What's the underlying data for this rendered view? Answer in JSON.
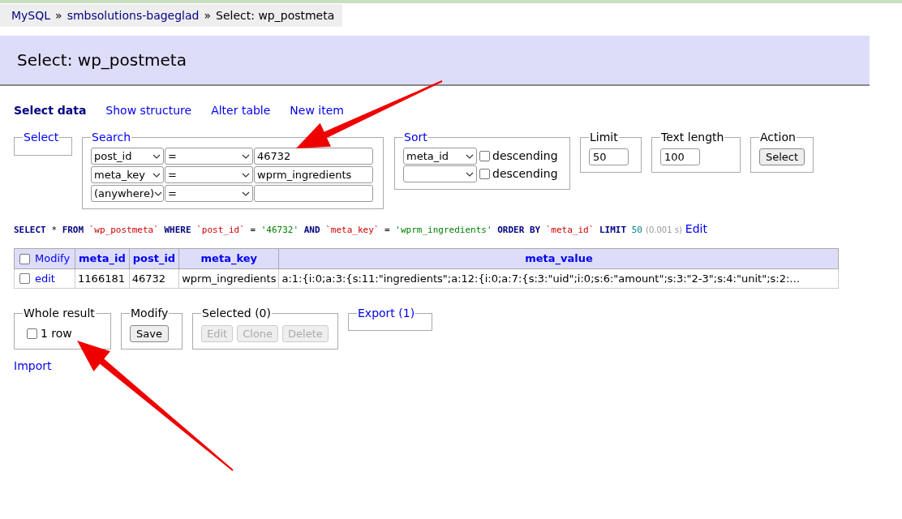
{
  "breadcrumb": {
    "separator": "»",
    "items": [
      {
        "text": "MySQL",
        "kind": "link"
      },
      {
        "text": "smbsolutions-bageglad",
        "kind": "link"
      },
      {
        "text": "Select: wp_postmeta",
        "kind": "current"
      }
    ]
  },
  "heading": "Select: wp_postmeta",
  "nav": [
    {
      "label": "Select data",
      "selected": true
    },
    {
      "label": "Show structure",
      "selected": false
    },
    {
      "label": "Alter table",
      "selected": false
    },
    {
      "label": "New item",
      "selected": false
    }
  ],
  "select_group": {
    "legend": "Select"
  },
  "search": {
    "legend": "Search",
    "rows": [
      {
        "column": "post_id",
        "operator": "=",
        "value": "46732"
      },
      {
        "column": "meta_key",
        "operator": "=",
        "value": "wprm_ingredients"
      },
      {
        "column": "(anywhere)",
        "operator": "="
      }
    ]
  },
  "sort": {
    "legend": "Sort",
    "rows": [
      {
        "column": "meta_id",
        "descending": false,
        "descending_label": "descending"
      },
      {
        "descending": false,
        "descending_label": "descending"
      }
    ]
  },
  "limit": {
    "legend": "Limit",
    "value": "50"
  },
  "text_length": {
    "legend": "Text length",
    "value": "100"
  },
  "action": {
    "legend": "Action",
    "button": "Select"
  },
  "query": {
    "tokens": [
      {
        "text": "SELECT",
        "kind": "keyword"
      },
      {
        "text": "*",
        "kind": "plain"
      },
      {
        "text": "FROM",
        "kind": "keyword"
      },
      {
        "text": "`wp_postmeta`",
        "kind": "identifier"
      },
      {
        "text": "WHERE",
        "kind": "keyword"
      },
      {
        "text": "`post_id`",
        "kind": "identifier"
      },
      {
        "text": "=",
        "kind": "plain"
      },
      {
        "text": "'46732'",
        "kind": "string"
      },
      {
        "text": "AND",
        "kind": "keyword"
      },
      {
        "text": "`meta_key`",
        "kind": "identifier"
      },
      {
        "text": "=",
        "kind": "plain"
      },
      {
        "text": "'wprm_ingredients'",
        "kind": "string"
      },
      {
        "text": "ORDER BY",
        "kind": "keyword"
      },
      {
        "text": "`meta_id`",
        "kind": "identifier"
      },
      {
        "text": "LIMIT",
        "kind": "keyword"
      },
      {
        "text": "50",
        "kind": "number"
      }
    ],
    "time": "(0.001 s)",
    "edit_link": "Edit"
  },
  "table": {
    "header_checked": false,
    "modify_label": "Modify",
    "columns": [
      "meta_id",
      "post_id",
      "meta_key",
      "meta_value"
    ],
    "rows": [
      {
        "checked": false,
        "action": "edit",
        "cells": [
          "1166181",
          "46732",
          "wprm_ingredients",
          "a:1:{i:0;a:3:{s:11:\"ingredients\";a:12:{i:0;a:7:{s:3:\"uid\";i:0;s:6:\"amount\";s:3:\"2-3\";s:4:\"unit\";s:2:…"
        ]
      }
    ]
  },
  "whole_result": {
    "legend": "Whole result",
    "checkbox_label": "1 row",
    "checked": false
  },
  "modify": {
    "legend": "Modify",
    "button": "Save"
  },
  "selected": {
    "legend": "Selected (0)",
    "buttons": [
      {
        "label": "Edit",
        "disabled": true
      },
      {
        "label": "Clone",
        "disabled": true
      },
      {
        "label": "Delete",
        "disabled": true
      }
    ]
  },
  "export": {
    "legend": "Export (1)"
  },
  "import_link": "Import"
}
